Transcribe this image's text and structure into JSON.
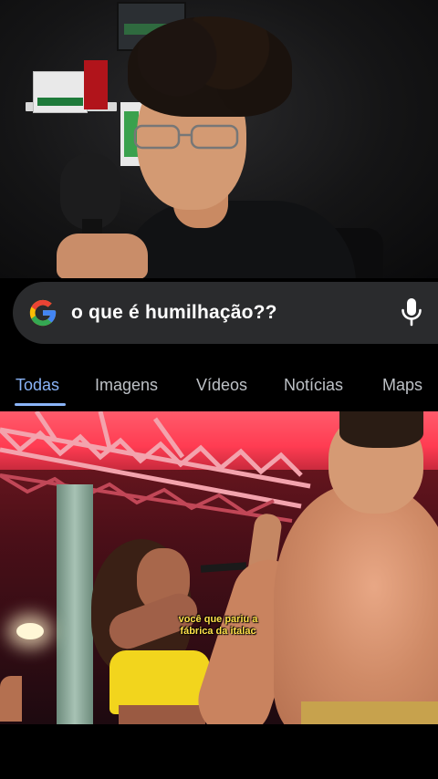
{
  "search": {
    "query": "o que é humilhação??",
    "logo_colors": {
      "blue": "#4285F4",
      "red": "#EA4335",
      "yellow": "#FBBC05",
      "green": "#34A853"
    }
  },
  "tabs": [
    {
      "label": "Todas",
      "active": true
    },
    {
      "label": "Imagens",
      "active": false
    },
    {
      "label": "Vídeos",
      "active": false
    },
    {
      "label": "Notícias",
      "active": false
    },
    {
      "label": "Maps",
      "active": false
    }
  ],
  "video_bottom": {
    "caption_line1": "você que pariu a",
    "caption_line2": "fábrica da italac"
  },
  "colors": {
    "tab_active": "#8ab4f8",
    "tab_inactive": "#bdc1c6",
    "search_bg": "#2a2b2d"
  }
}
